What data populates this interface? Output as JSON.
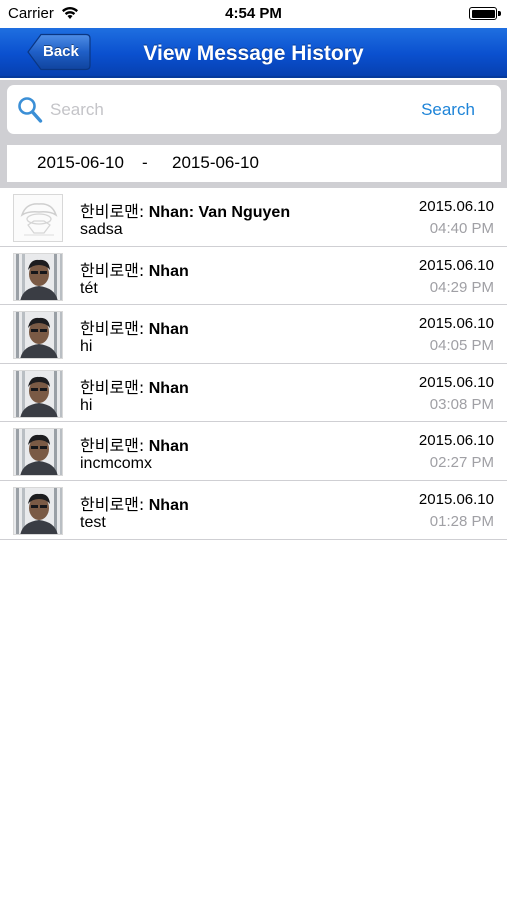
{
  "status_bar": {
    "carrier": "Carrier",
    "time": "4:54 PM"
  },
  "nav": {
    "back_label": "Back",
    "title": "View Message History"
  },
  "search": {
    "placeholder": "Search",
    "value": "",
    "button_label": "Search"
  },
  "date_range": {
    "from": "2015-06-10",
    "separator": "-",
    "to": "2015-06-10"
  },
  "messages": [
    {
      "avatar": "placeholder-avatar",
      "sender_prefix": "한비로맨:",
      "sender_name": "Nhan: Van Nguyen",
      "text": "sadsa",
      "date": "2015.06.10",
      "time": "04:40 PM"
    },
    {
      "avatar": "user-photo",
      "sender_prefix": "한비로맨:",
      "sender_name": "Nhan",
      "text": "tét",
      "date": "2015.06.10",
      "time": "04:29 PM"
    },
    {
      "avatar": "user-photo",
      "sender_prefix": "한비로맨:",
      "sender_name": "Nhan",
      "text": "hi",
      "date": "2015.06.10",
      "time": "04:05 PM"
    },
    {
      "avatar": "user-photo",
      "sender_prefix": "한비로맨:",
      "sender_name": "Nhan",
      "text": "hi",
      "date": "2015.06.10",
      "time": "03:08 PM"
    },
    {
      "avatar": "user-photo",
      "sender_prefix": "한비로맨:",
      "sender_name": "Nhan",
      "text": "incmcomx",
      "date": "2015.06.10",
      "time": "02:27 PM"
    },
    {
      "avatar": "user-photo",
      "sender_prefix": "한비로맨:",
      "sender_name": "Nhan",
      "text": "test",
      "date": "2015.06.10",
      "time": "01:28 PM"
    }
  ],
  "colors": {
    "nav_blue": "#0a50cf",
    "search_button": "#1e84d8",
    "time_gray": "#a0a0a5",
    "separator": "#cfcfd3"
  }
}
